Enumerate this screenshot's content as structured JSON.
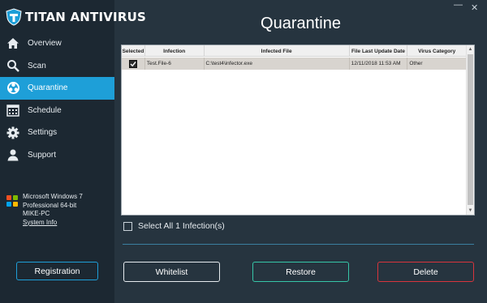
{
  "app": {
    "title": "TITAN ANTIVIRUS",
    "window_min": "—",
    "window_close": "✕"
  },
  "sidebar": {
    "items": [
      {
        "label": "Overview",
        "icon": "home-icon",
        "active": false
      },
      {
        "label": "Scan",
        "icon": "search-icon",
        "active": false
      },
      {
        "label": "Quarantine",
        "icon": "biohazard-icon",
        "active": true
      },
      {
        "label": "Schedule",
        "icon": "calendar-icon",
        "active": false
      },
      {
        "label": "Settings",
        "icon": "gear-icon",
        "active": false
      },
      {
        "label": "Support",
        "icon": "user-icon",
        "active": false
      }
    ],
    "system": {
      "os": "Microsoft Windows 7",
      "edition": "Professional  64-bit",
      "machine": "MIKE-PC",
      "link": "System Info"
    },
    "registration_label": "Registration"
  },
  "main": {
    "title": "Quarantine",
    "table": {
      "columns": [
        "Selected",
        "Infection",
        "Infected File",
        "File Last Update Date",
        "Virus Category"
      ],
      "rows": [
        {
          "selected": true,
          "infection": "Test.File-6",
          "file": "C:\\test4\\infector.exe",
          "date": "12/11/2018 11:53 AM",
          "category": "Other"
        }
      ]
    },
    "select_all_label": "Select All 1 Infection(s)",
    "buttons": {
      "whitelist": "Whitelist",
      "restore": "Restore",
      "delete": "Delete"
    }
  },
  "colors": {
    "accent": "#1e9fd8",
    "restore": "#36c6a8",
    "delete": "#d8343c",
    "sidebar_bg": "#1c2832",
    "main_bg": "#26343f"
  }
}
